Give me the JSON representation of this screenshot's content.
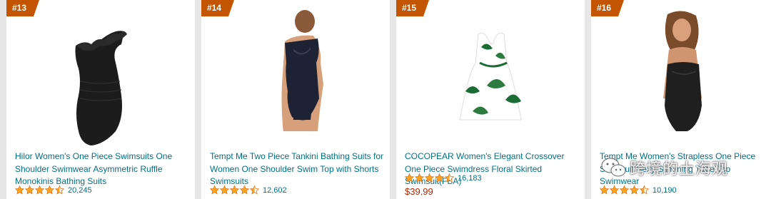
{
  "products": [
    {
      "rank": "#13",
      "title": "Hilor Women's One Piece Swimsuits One Shoulder Swimwear Asymmetric Ruffle Monokinis Bathing Suits",
      "rating": 4.5,
      "reviews": "20,245",
      "price": ""
    },
    {
      "rank": "#14",
      "title": "Tempt Me Two Piece Tankini Bathing Suits for Women One Shoulder Swim Top with Shorts Swimsuits",
      "rating": 4.5,
      "reviews": "12,602",
      "price": ""
    },
    {
      "rank": "#15",
      "title": "COCOPEAR Women's Elegant Crossover One Piece Swimdress Floral Skirted Swimsuit(FBA)",
      "rating": 4.5,
      "reviews": "16,183",
      "price": "$39.99"
    },
    {
      "rank": "#16",
      "title": "Tempt Me Women's Strapless One Piece Swimsuit Sexy Slimming Tube Top Swimwear",
      "rating": 4.5,
      "reviews": "10,190",
      "price": ""
    }
  ],
  "colors": {
    "rank_badge": "#c45500",
    "link": "#007185",
    "star": "#ffa41c",
    "price": "#b12704"
  },
  "watermark": {
    "icon": "wechat-icon",
    "text": "跨境的土海观"
  }
}
